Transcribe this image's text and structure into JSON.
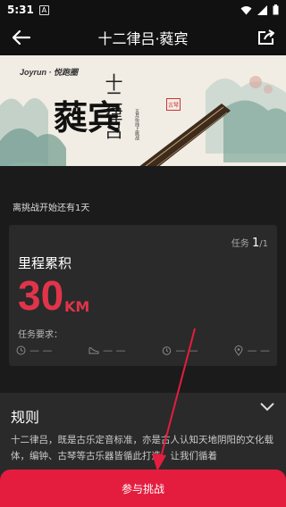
{
  "status_bar": {
    "time": "5:31",
    "notif_letter": "A"
  },
  "header": {
    "title": "十二律吕·蕤宾"
  },
  "banner": {
    "brand": "Joyrun · 悦跑圈",
    "title_small": "十二律吕",
    "title_big": "蕤宾",
    "subtitle": "五月份线上挑战",
    "seal": "古琴"
  },
  "countdown": "离挑战开始还有1天",
  "card": {
    "task_label": "任务",
    "task_current": "1",
    "task_total": "/1",
    "metric_label": "里程累积",
    "metric_value": "30",
    "metric_unit": "KM",
    "requirements_label": "任务要求：",
    "requirements": [
      {
        "icon": "clock-icon",
        "value": "— —"
      },
      {
        "icon": "shoe-icon",
        "value": "— —"
      },
      {
        "icon": "timer-icon",
        "value": "— —"
      },
      {
        "icon": "location-icon",
        "value": "— —"
      }
    ]
  },
  "rules": {
    "heading": "规则",
    "text": "十二律吕，既是古乐定音标准，亦是古人认知天地阴阳的文化载体，编钟、古琴等古乐器皆循此打造。让我们循着"
  },
  "cta_label": "参与挑战",
  "colors": {
    "accent": "#e41d3e",
    "metric": "#e0344a",
    "card": "#2a2a2a",
    "bg": "#1b1b1b"
  }
}
